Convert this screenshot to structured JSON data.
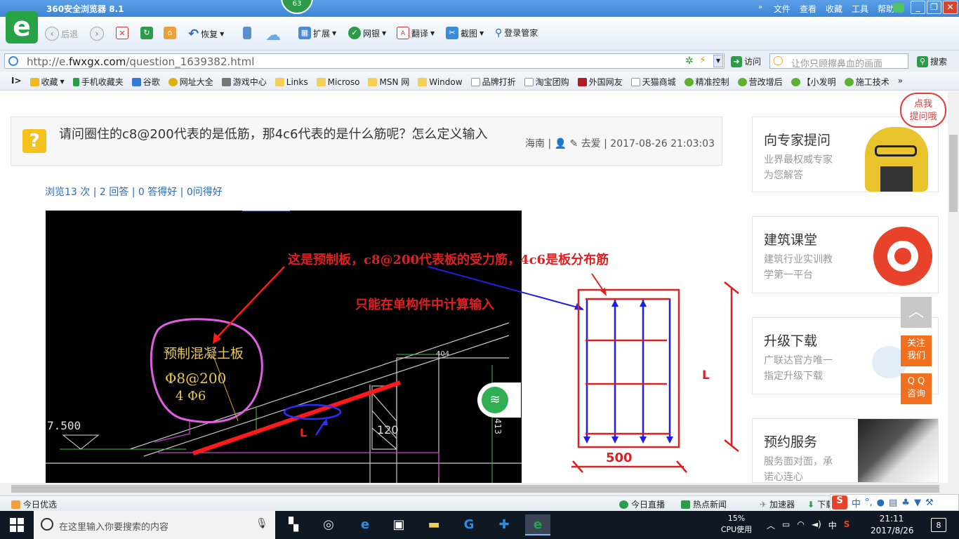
{
  "browser": {
    "title": "360安全浏览器 8.1",
    "badge": "63",
    "menu": [
      "文件",
      "查看",
      "收藏",
      "工具",
      "帮助"
    ],
    "win_min": "_",
    "win_restore": "❐",
    "win_close": "✕"
  },
  "toolbar": {
    "back": "后退",
    "restore": "恢复",
    "extend": "扩展",
    "netbank": "网银",
    "translate": "翻译",
    "screenshot": "截图",
    "login_manager": "登录管家"
  },
  "address": {
    "url_prefix": "http://e.",
    "url_domain": "fwxgx.com",
    "url_path": "/question_1639382.html",
    "go": "访问",
    "search_placeholder": "让你只顾擦鼻血的画面",
    "search_btn": "搜索"
  },
  "favorites": [
    "收藏",
    "手机收藏夹",
    "谷歌",
    "网址大全",
    "游戏中心",
    "Links",
    "Microso",
    "MSN 网",
    "Window",
    "品牌打折",
    "淘宝团购",
    "外国网友",
    "天猫商城",
    "精准控制",
    "营改增后",
    "【小发明",
    "施工技术"
  ],
  "question": {
    "icon": "?",
    "title": "请问圈住的c8@200代表的是低筋，那4c6代表的是什么筋呢？怎么定义输入",
    "meta": "海南 | 👤 ✎ 去爱 | 2017-08-26 21:03:03",
    "stats": "浏览13 次 | 2 回答 | 0 答得好 | 0问得好"
  },
  "drawing": {
    "annotation1": "这是预制板，c8@200代表板的受力筋，4c6是板分布筋",
    "annotation2": "只能在单构件中计算输入",
    "label_cad": "预制混凝土板",
    "rebar1": "Φ8@200",
    "rebar2": "4 Φ6",
    "elev": "7.500",
    "dim404": "404",
    "dim120": "120",
    "dim413": "413",
    "L1": "L",
    "L2": "L",
    "width": "500"
  },
  "sidebar": [
    {
      "title": "向专家提问",
      "desc1": "业界最权威专家",
      "desc2": "为您解答"
    },
    {
      "title": "建筑课堂",
      "desc1": "建筑行业实训教",
      "desc2": "学第一平台"
    },
    {
      "title": "升级下载",
      "desc1": "广联达官方唯一",
      "desc2": "指定升级下载"
    },
    {
      "title": "预约服务",
      "desc1": "服务面对面，承",
      "desc2": "诺心连心"
    }
  ],
  "float": {
    "bubble1": "点我",
    "bubble2": "提问哦",
    "top": "︿",
    "follow1": "关注",
    "follow2": "我们",
    "qq1": "Q Q",
    "qq2": "咨询"
  },
  "status": {
    "left": "今日优选",
    "live": "今日直播",
    "news": "热点新闻",
    "accel": "加速器",
    "download": "下载"
  },
  "taskbar": {
    "search_placeholder": "在这里输入你要搜索的内容",
    "cpu_pct": "15%",
    "cpu_label": "CPU使用",
    "ime": "中",
    "time": "21:11",
    "date": "2017/8/26",
    "notif": "8"
  },
  "colors": {
    "accent": "#27a345",
    "link": "#2b6bb8",
    "annotation": "#e02020",
    "popup": "#f07020"
  }
}
